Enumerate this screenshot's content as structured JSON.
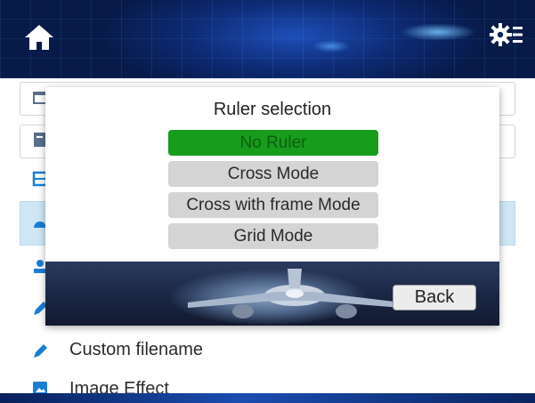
{
  "header": {
    "home_icon": "home-icon",
    "settings_icon": "settings-gear-icon"
  },
  "list": {
    "items": [
      {
        "label": "Custom filename",
        "icon": "pencil-icon",
        "icon_color": "#1a7fd6"
      },
      {
        "label": "Image Effect",
        "icon": "image-icon",
        "icon_color": "#1a7fd6"
      }
    ]
  },
  "dialog": {
    "title": "Ruler selection",
    "options": [
      {
        "label": "No Ruler",
        "selected": true
      },
      {
        "label": "Cross Mode",
        "selected": false
      },
      {
        "label": "Cross with frame Mode",
        "selected": false
      },
      {
        "label": "Grid Mode",
        "selected": false
      }
    ],
    "back_label": "Back"
  },
  "colors": {
    "selected_option": "#179c1c",
    "option_bg": "#d4d4d4",
    "header_bg": "#0b2463"
  }
}
